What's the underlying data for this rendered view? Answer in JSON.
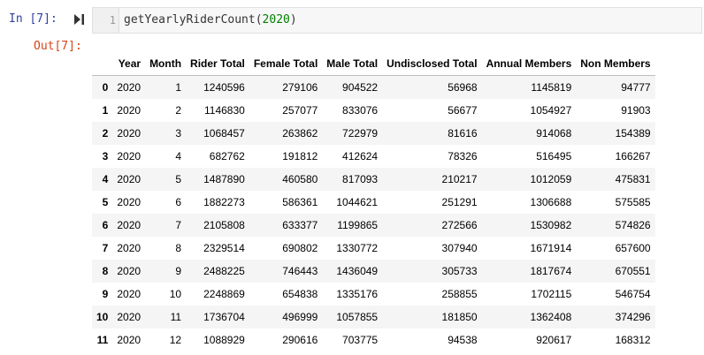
{
  "input_cell": {
    "prompt": "In [7]:",
    "line_number": "1",
    "code_func": "getYearlyRiderCount(",
    "code_arg": "2020",
    "code_close": ")"
  },
  "output_cell": {
    "prompt": "Out[7]:"
  },
  "table": {
    "index_header": "",
    "columns": [
      "Year",
      "Month",
      "Rider Total",
      "Female Total",
      "Male Total",
      "Undisclosed Total",
      "Annual Members",
      "Non Members"
    ],
    "rows": [
      {
        "index": "0",
        "cells": [
          "2020",
          "1",
          "1240596",
          "279106",
          "904522",
          "56968",
          "1145819",
          "94777"
        ]
      },
      {
        "index": "1",
        "cells": [
          "2020",
          "2",
          "1146830",
          "257077",
          "833076",
          "56677",
          "1054927",
          "91903"
        ]
      },
      {
        "index": "2",
        "cells": [
          "2020",
          "3",
          "1068457",
          "263862",
          "722979",
          "81616",
          "914068",
          "154389"
        ]
      },
      {
        "index": "3",
        "cells": [
          "2020",
          "4",
          "682762",
          "191812",
          "412624",
          "78326",
          "516495",
          "166267"
        ]
      },
      {
        "index": "4",
        "cells": [
          "2020",
          "5",
          "1487890",
          "460580",
          "817093",
          "210217",
          "1012059",
          "475831"
        ]
      },
      {
        "index": "5",
        "cells": [
          "2020",
          "6",
          "1882273",
          "586361",
          "1044621",
          "251291",
          "1306688",
          "575585"
        ]
      },
      {
        "index": "6",
        "cells": [
          "2020",
          "7",
          "2105808",
          "633377",
          "1199865",
          "272566",
          "1530982",
          "574826"
        ]
      },
      {
        "index": "7",
        "cells": [
          "2020",
          "8",
          "2329514",
          "690802",
          "1330772",
          "307940",
          "1671914",
          "657600"
        ]
      },
      {
        "index": "8",
        "cells": [
          "2020",
          "9",
          "2488225",
          "746443",
          "1436049",
          "305733",
          "1817674",
          "670551"
        ]
      },
      {
        "index": "9",
        "cells": [
          "2020",
          "10",
          "2248869",
          "654838",
          "1335176",
          "258855",
          "1702115",
          "546754"
        ]
      },
      {
        "index": "10",
        "cells": [
          "2020",
          "11",
          "1736704",
          "496999",
          "1057855",
          "181850",
          "1362408",
          "374296"
        ]
      },
      {
        "index": "11",
        "cells": [
          "2020",
          "12",
          "1088929",
          "290616",
          "703775",
          "94538",
          "920617",
          "168312"
        ]
      }
    ]
  },
  "icons": {
    "run": "run-cell-icon"
  },
  "colors": {
    "in_prompt": "#303f9f",
    "out_prompt": "#d84315",
    "code_number": "#008000"
  }
}
